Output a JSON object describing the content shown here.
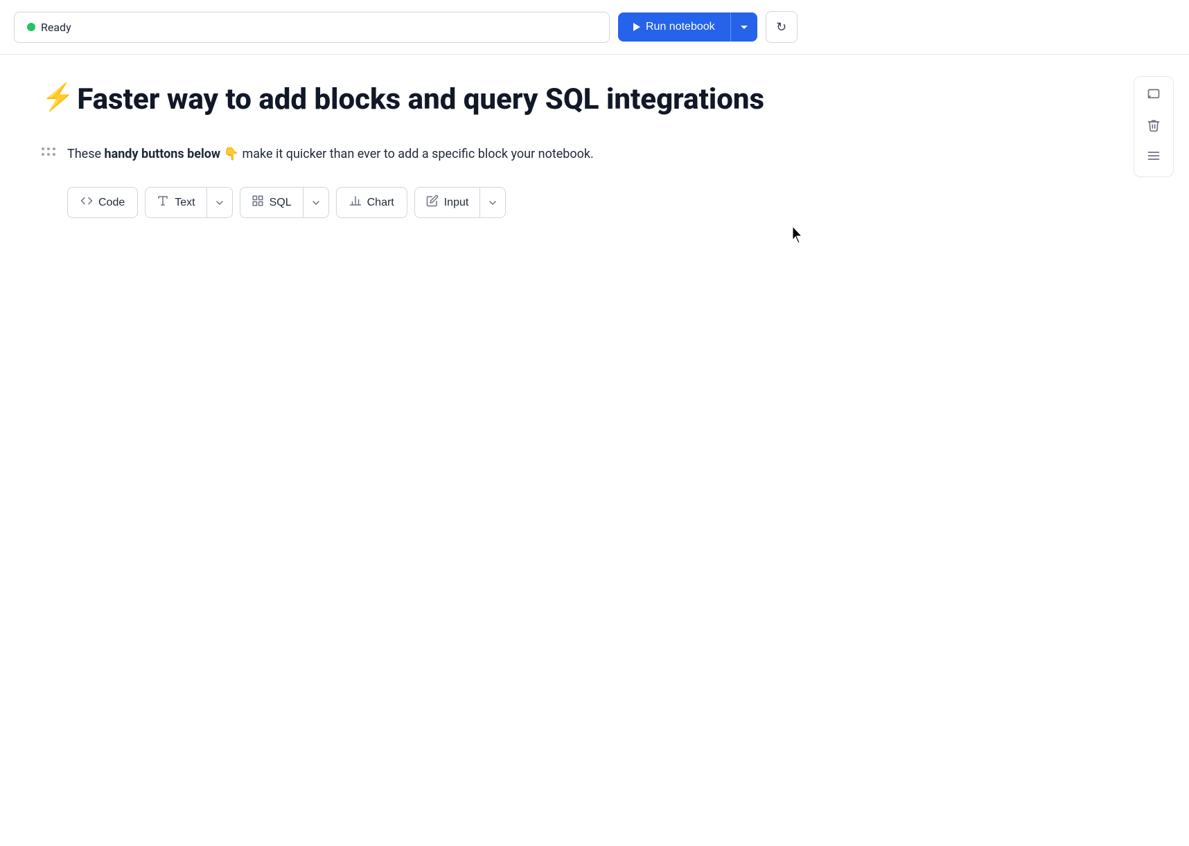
{
  "header": {
    "status_label": "Ready",
    "status_color": "#22c55e",
    "run_button_label": "Run notebook",
    "refresh_tooltip": "Refresh"
  },
  "sidebar": {
    "buttons": [
      {
        "name": "comment-icon",
        "symbol": "💬",
        "unicode": "▤"
      },
      {
        "name": "delete-icon",
        "symbol": "🗑",
        "unicode": "⊟"
      },
      {
        "name": "menu-icon",
        "symbol": "☰",
        "unicode": "≡"
      }
    ]
  },
  "page": {
    "title_emoji": "⚡",
    "title_text": "Faster way to add blocks and query SQL integrations",
    "description_prefix": "These ",
    "description_bold": "handy buttons below",
    "description_emoji": "👇",
    "description_suffix": " make it quicker than ever to add a specific block your notebook."
  },
  "buttons": [
    {
      "id": "code",
      "label": "Code",
      "icon": "<>",
      "has_dropdown": false
    },
    {
      "id": "text",
      "label": "Text",
      "icon": "Tr",
      "has_dropdown": true
    },
    {
      "id": "sql",
      "label": "SQL",
      "icon": "grid",
      "has_dropdown": true
    },
    {
      "id": "chart",
      "label": "Chart",
      "icon": "chart",
      "has_dropdown": false
    },
    {
      "id": "input",
      "label": "Input",
      "icon": "pencil",
      "has_dropdown": true
    }
  ]
}
